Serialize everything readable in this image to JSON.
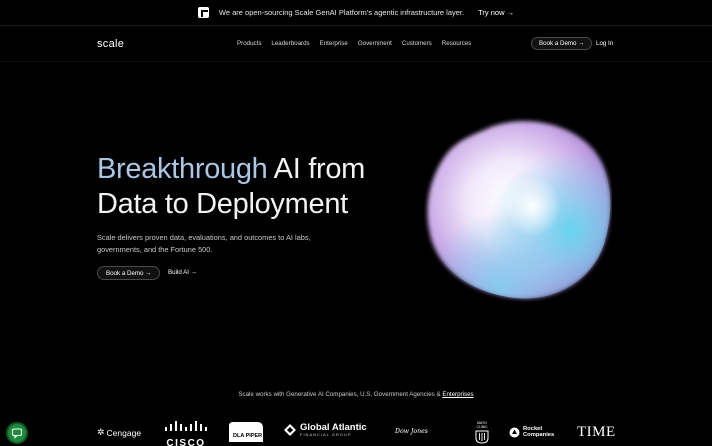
{
  "announcement": {
    "text": "We are open-sourcing Scale GenAI Platform's agentic infrastructure layer.",
    "cta": "Try now →"
  },
  "nav": {
    "brand": "scale",
    "items": [
      "Products",
      "Leaderboards",
      "Enterprise",
      "Government",
      "Customers",
      "Resources"
    ],
    "book_demo": "Book a Demo →",
    "login": "Log In"
  },
  "hero": {
    "title_accent": "Breakthrough",
    "title_rest_line1": " AI from",
    "title_line2": "Data to Deployment",
    "subtitle": "Scale delivers proven data, evaluations, and outcomes to AI labs, governments, and the Fortune 500.",
    "cta_primary": "Book a Demo →",
    "cta_secondary": "Build AI →"
  },
  "partners": {
    "caption_prefix": "Scale works with Generative AI Companies, U.S. Government Agencies & ",
    "caption_link": "Enterprises",
    "logos": {
      "cengage": "Cengage",
      "cisco": "CISCO",
      "dla": "DLA PIPER",
      "ga_main": "Global Atlantic",
      "ga_sub": "FINANCIAL GROUP",
      "dj": "Dow Jones",
      "mayo": "MAYO CLINIC",
      "rocket_line1": "Rocket",
      "rocket_line2": "Companies",
      "time": "TIME"
    }
  },
  "colors": {
    "background": "#000000",
    "accent": "#a8c8e6",
    "chat_badge": "#1a8c3a"
  }
}
